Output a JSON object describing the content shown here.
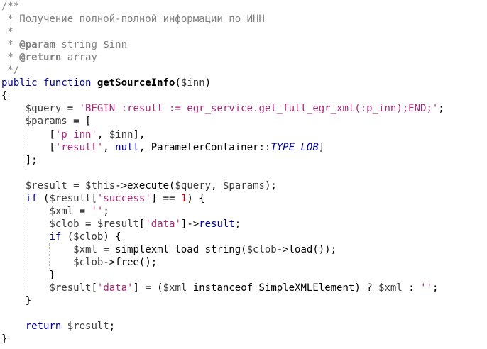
{
  "code": {
    "lines": [
      [
        {
          "t": "/**",
          "c": "comment"
        }
      ],
      [
        {
          "t": " * Получение полной-полной информации по ИНН",
          "c": "comment"
        }
      ],
      [
        {
          "t": " *",
          "c": "comment"
        }
      ],
      [
        {
          "t": " * ",
          "c": "comment"
        },
        {
          "t": "@param",
          "c": "doctag"
        },
        {
          "t": " string $inn",
          "c": "comment"
        }
      ],
      [
        {
          "t": " * ",
          "c": "comment"
        },
        {
          "t": "@return",
          "c": "doctag"
        },
        {
          "t": " array",
          "c": "comment"
        }
      ],
      [
        {
          "t": " */",
          "c": "comment"
        }
      ],
      [
        {
          "t": "public",
          "c": "keyword"
        },
        {
          "t": " ",
          "c": "plain"
        },
        {
          "t": "function",
          "c": "keyword"
        },
        {
          "t": " ",
          "c": "plain"
        },
        {
          "t": "getSourceInfo",
          "c": "func"
        },
        {
          "t": "(",
          "c": "plain"
        },
        {
          "t": "$inn",
          "c": "var"
        },
        {
          "t": ")",
          "c": "plain"
        }
      ],
      [
        {
          "t": "{",
          "c": "plain"
        }
      ],
      [
        {
          "t": "    ",
          "c": "plain"
        },
        {
          "t": "$query",
          "c": "var"
        },
        {
          "t": " = ",
          "c": "plain"
        },
        {
          "t": "'BEGIN :result := egr_service.get_full_egr_xml(:p_inn);END;'",
          "c": "string"
        },
        {
          "t": ";",
          "c": "plain"
        }
      ],
      [
        {
          "t": "    ",
          "c": "plain"
        },
        {
          "t": "$params",
          "c": "var"
        },
        {
          "t": " = [",
          "c": "plain"
        }
      ],
      [
        {
          "t": "        [",
          "c": "plain"
        },
        {
          "t": "'p_inn'",
          "c": "string"
        },
        {
          "t": ", ",
          "c": "plain"
        },
        {
          "t": "$inn",
          "c": "var"
        },
        {
          "t": "],",
          "c": "plain"
        }
      ],
      [
        {
          "t": "        [",
          "c": "plain"
        },
        {
          "t": "'result'",
          "c": "string"
        },
        {
          "t": ", ",
          "c": "plain"
        },
        {
          "t": "null",
          "c": "keyword"
        },
        {
          "t": ", ParameterContainer::",
          "c": "plain"
        },
        {
          "t": "TYPE_LOB",
          "c": "const"
        },
        {
          "t": "]",
          "c": "plain"
        }
      ],
      [
        {
          "t": "    ];",
          "c": "plain"
        }
      ],
      [],
      [
        {
          "t": "    ",
          "c": "plain"
        },
        {
          "t": "$result",
          "c": "var"
        },
        {
          "t": " = ",
          "c": "plain"
        },
        {
          "t": "$this",
          "c": "var"
        },
        {
          "t": "->execute(",
          "c": "plain"
        },
        {
          "t": "$query",
          "c": "var"
        },
        {
          "t": ", ",
          "c": "plain"
        },
        {
          "t": "$params",
          "c": "var"
        },
        {
          "t": ");",
          "c": "plain"
        }
      ],
      [
        {
          "t": "    ",
          "c": "plain"
        },
        {
          "t": "if",
          "c": "keyword"
        },
        {
          "t": " (",
          "c": "plain"
        },
        {
          "t": "$result",
          "c": "var"
        },
        {
          "t": "[",
          "c": "plain"
        },
        {
          "t": "'success'",
          "c": "string"
        },
        {
          "t": "] == ",
          "c": "plain"
        },
        {
          "t": "1",
          "c": "number"
        },
        {
          "t": ") {",
          "c": "plain"
        }
      ],
      [
        {
          "t": "        ",
          "c": "plain"
        },
        {
          "t": "$xml",
          "c": "var"
        },
        {
          "t": " = ",
          "c": "plain"
        },
        {
          "t": "''",
          "c": "string"
        },
        {
          "t": ";",
          "c": "plain"
        }
      ],
      [
        {
          "t": "        ",
          "c": "plain"
        },
        {
          "t": "$clob",
          "c": "var"
        },
        {
          "t": " = ",
          "c": "plain"
        },
        {
          "t": "$result",
          "c": "var"
        },
        {
          "t": "[",
          "c": "plain"
        },
        {
          "t": "'data'",
          "c": "string"
        },
        {
          "t": "]->",
          "c": "plain"
        },
        {
          "t": "result",
          "c": "keyword"
        },
        {
          "t": ";",
          "c": "plain"
        }
      ],
      [
        {
          "t": "        ",
          "c": "plain"
        },
        {
          "t": "if",
          "c": "keyword"
        },
        {
          "t": " (",
          "c": "plain"
        },
        {
          "t": "$clob",
          "c": "var"
        },
        {
          "t": ") {",
          "c": "plain"
        }
      ],
      [
        {
          "t": "            ",
          "c": "plain"
        },
        {
          "t": "$xml",
          "c": "var"
        },
        {
          "t": " = simplexml_load_string(",
          "c": "plain"
        },
        {
          "t": "$clob",
          "c": "var"
        },
        {
          "t": "->load());",
          "c": "plain"
        }
      ],
      [
        {
          "t": "            ",
          "c": "plain"
        },
        {
          "t": "$clob",
          "c": "var"
        },
        {
          "t": "->free();",
          "c": "plain"
        }
      ],
      [
        {
          "t": "        }",
          "c": "plain"
        }
      ],
      [
        {
          "t": "        ",
          "c": "plain"
        },
        {
          "t": "$result",
          "c": "var"
        },
        {
          "t": "[",
          "c": "plain"
        },
        {
          "t": "'data'",
          "c": "string"
        },
        {
          "t": "] = (",
          "c": "plain"
        },
        {
          "t": "$xml",
          "c": "var"
        },
        {
          "t": " instanceof SimpleXMLElement) ? ",
          "c": "plain"
        },
        {
          "t": "$xml",
          "c": "var"
        },
        {
          "t": " : ",
          "c": "plain"
        },
        {
          "t": "''",
          "c": "string"
        },
        {
          "t": ";",
          "c": "plain"
        }
      ],
      [
        {
          "t": "    }",
          "c": "plain"
        }
      ],
      [],
      [
        {
          "t": "    ",
          "c": "plain"
        },
        {
          "t": "return",
          "c": "keyword"
        },
        {
          "t": " ",
          "c": "plain"
        },
        {
          "t": "$result",
          "c": "var"
        },
        {
          "t": ";",
          "c": "plain"
        }
      ],
      [
        {
          "t": "}",
          "c": "plain"
        }
      ]
    ],
    "indent_guides": [
      {
        "column": 4,
        "from_line": 10,
        "to_line": 12
      },
      {
        "column": 4,
        "from_line": 16,
        "to_line": 22
      },
      {
        "column": 8,
        "from_line": 19,
        "to_line": 20
      }
    ]
  }
}
